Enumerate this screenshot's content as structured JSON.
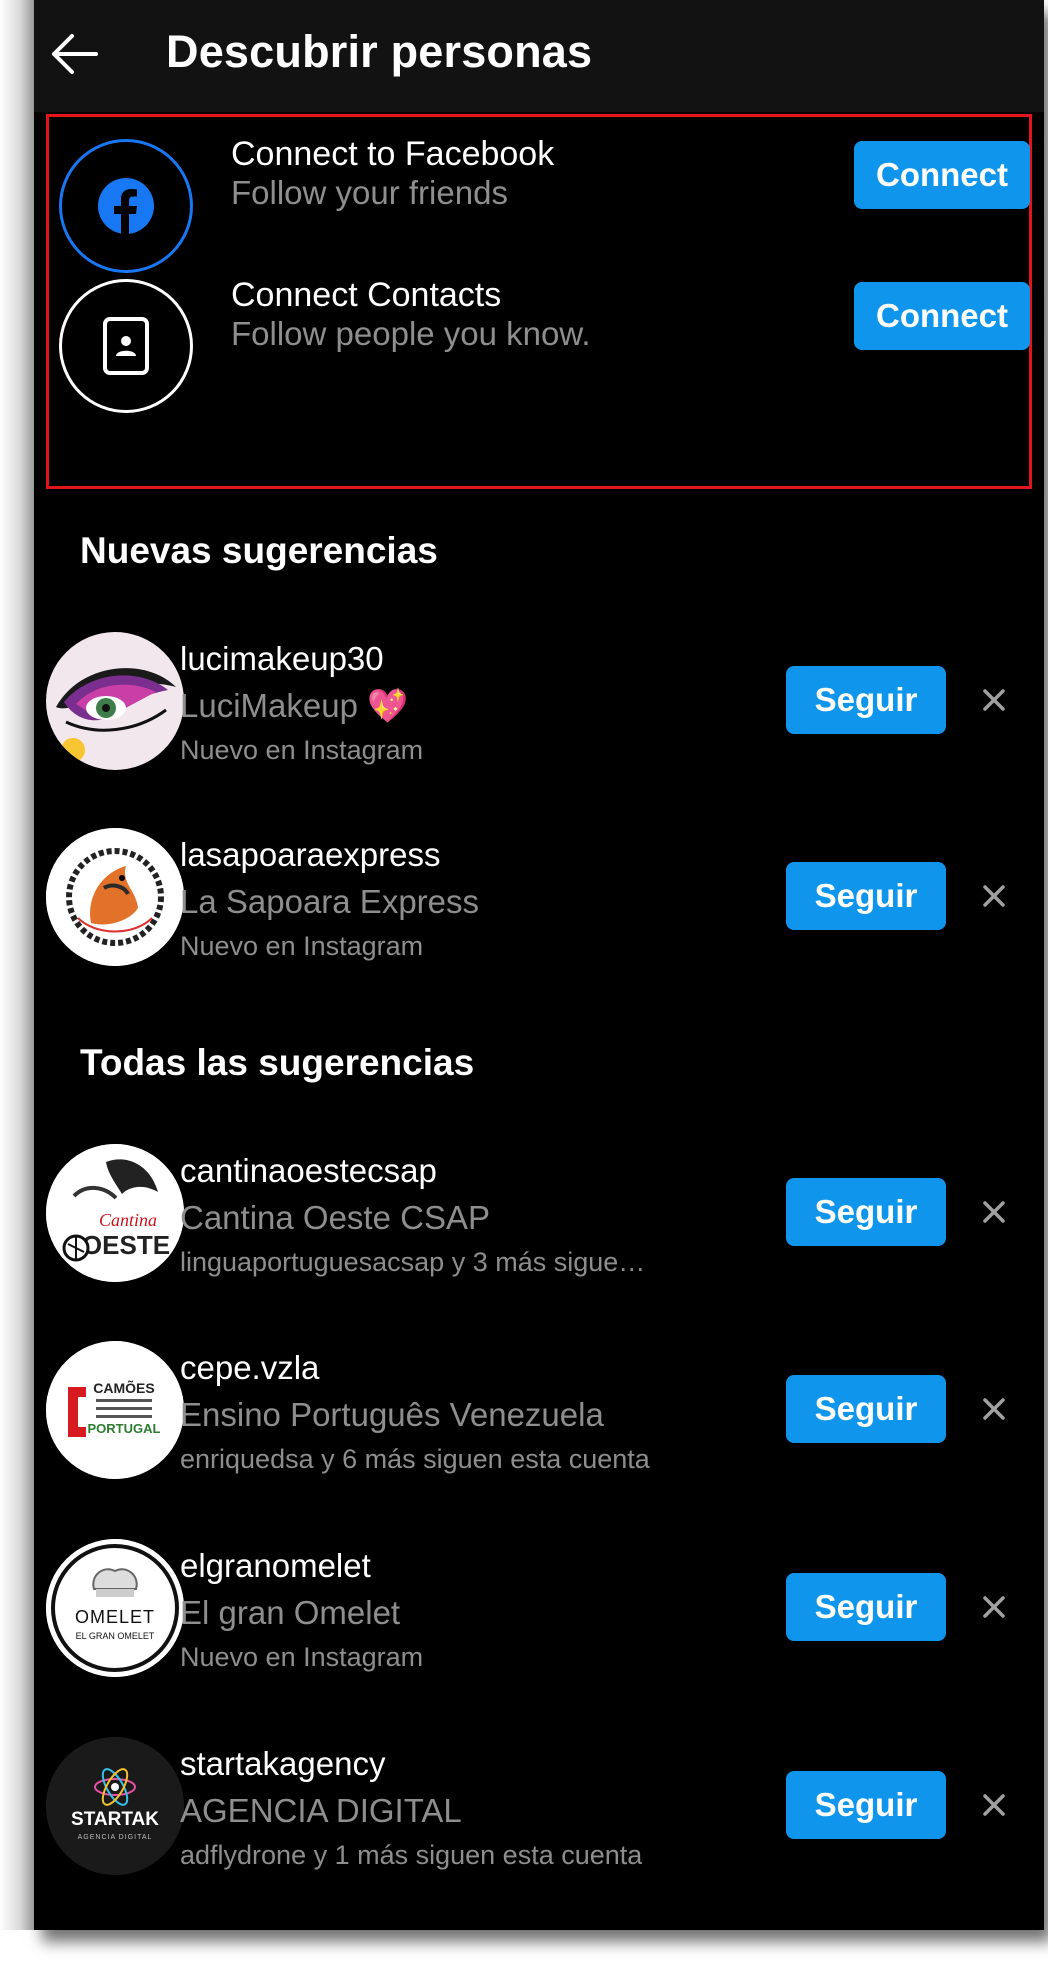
{
  "header": {
    "title": "Descubrir personas"
  },
  "connect": [
    {
      "title": "Connect to Facebook",
      "subtitle": "Follow your friends",
      "button": "Connect",
      "icon": "facebook-icon"
    },
    {
      "title": "Connect Contacts",
      "subtitle": "Follow people you know.",
      "button": "Connect",
      "icon": "contact-card-icon"
    }
  ],
  "sections": {
    "new": "Nuevas sugerencias",
    "all": "Todas las sugerencias"
  },
  "new_suggestions": [
    {
      "username": "lucimakeup30",
      "fullname": "LuciMakeup 💖",
      "meta": "Nuevo en Instagram",
      "button": "Seguir"
    },
    {
      "username": "lasapoaraexpress",
      "fullname": "La Sapoara Express",
      "meta": "Nuevo en Instagram",
      "button": "Seguir"
    }
  ],
  "all_suggestions": [
    {
      "username": "cantinaoestecsap",
      "fullname": "Cantina Oeste CSAP",
      "meta": "linguaportuguesacsap y 3 más sigue…",
      "button": "Seguir",
      "avatar_text": [
        "Cantina",
        "OESTE"
      ]
    },
    {
      "username": "cepe.vzla",
      "fullname": "Ensino Português Venezuela",
      "meta": "enriquedsa y 6 más siguen esta cuenta",
      "button": "Seguir",
      "avatar_text": [
        "CAMÕES",
        "PORTUGAL"
      ]
    },
    {
      "username": "elgranomelet",
      "fullname": "El gran Omelet",
      "meta": "Nuevo en Instagram",
      "button": "Seguir",
      "avatar_text": [
        "OMELET",
        "EL GRAN OMELET"
      ]
    },
    {
      "username": "startakagency",
      "fullname": "AGENCIA DIGITAL",
      "meta": "adflydrone y 1 más siguen esta cuenta",
      "button": "Seguir",
      "avatar_text": [
        "STARTAK",
        "AGENCIA DIGITAL"
      ]
    }
  ],
  "colors": {
    "accent": "#0f96ec",
    "background": "#000000",
    "highlight_border": "#e2151d",
    "secondary_text": "#8e8e8e"
  }
}
